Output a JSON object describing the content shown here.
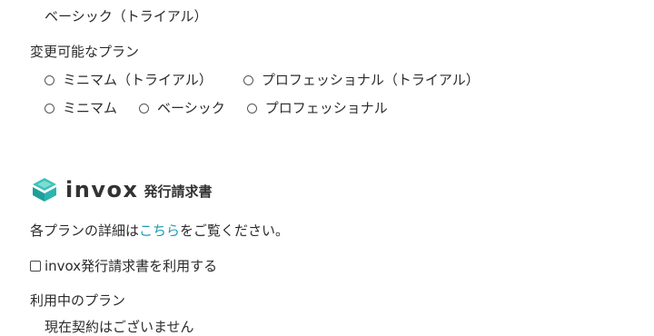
{
  "upper": {
    "current_plan": "ベーシック（トライアル）",
    "changeable_label": "変更可能なプラン",
    "options_row1": [
      "ミニマム（トライアル）",
      "プロフェッショナル（トライアル）"
    ],
    "options_row2": [
      "ミニマム",
      "ベーシック",
      "プロフェッショナル"
    ]
  },
  "invox_section": {
    "logo_word": "invox",
    "logo_sub": "発行請求書",
    "details_prefix": "各プランの詳細は",
    "details_link": "こちら",
    "details_suffix": "をご覧ください。",
    "use_checkbox_label": "invox発行請求書を利用する",
    "current_plan_label": "利用中のプラン",
    "current_plan_value": "現在契約はございません"
  },
  "colors": {
    "link": "#1a9bb0",
    "logo_icon": "#2bb5b0"
  }
}
